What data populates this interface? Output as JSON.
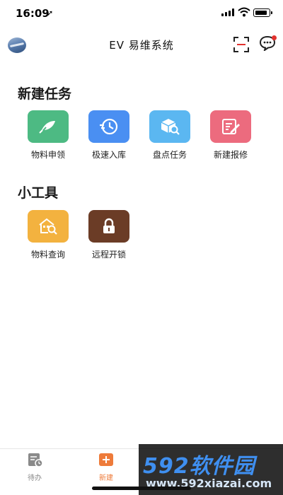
{
  "status_bar": {
    "time": "16:09",
    "location_arrow": "➚"
  },
  "header": {
    "title": "EV 易维系统"
  },
  "sections": [
    {
      "title": "新建任务",
      "items": [
        {
          "label": "物料申领",
          "icon": "leaf-pen-icon",
          "color": "#4dba83"
        },
        {
          "label": "极速入库",
          "icon": "fast-clock-icon",
          "color": "#4a8ff2"
        },
        {
          "label": "盘点任务",
          "icon": "box-search-icon",
          "color": "#5bb7f1"
        },
        {
          "label": "新建报修",
          "icon": "edit-form-icon",
          "color": "#ec6b7e"
        }
      ]
    },
    {
      "title": "小工具",
      "items": [
        {
          "label": "物料查询",
          "icon": "house-search-icon",
          "color": "#f3b23f"
        },
        {
          "label": "远程开锁",
          "icon": "lock-icon",
          "color": "#6b3c26"
        }
      ]
    }
  ],
  "tab_bar": {
    "items": [
      {
        "label": "待办",
        "icon": "todo-icon",
        "color": "#8a8a8a"
      },
      {
        "label": "新建",
        "icon": "new-plus-icon",
        "color": "#ee7b3a"
      }
    ]
  },
  "watermark": {
    "big": "592软件园",
    "small": "www.592xiazai.com"
  }
}
